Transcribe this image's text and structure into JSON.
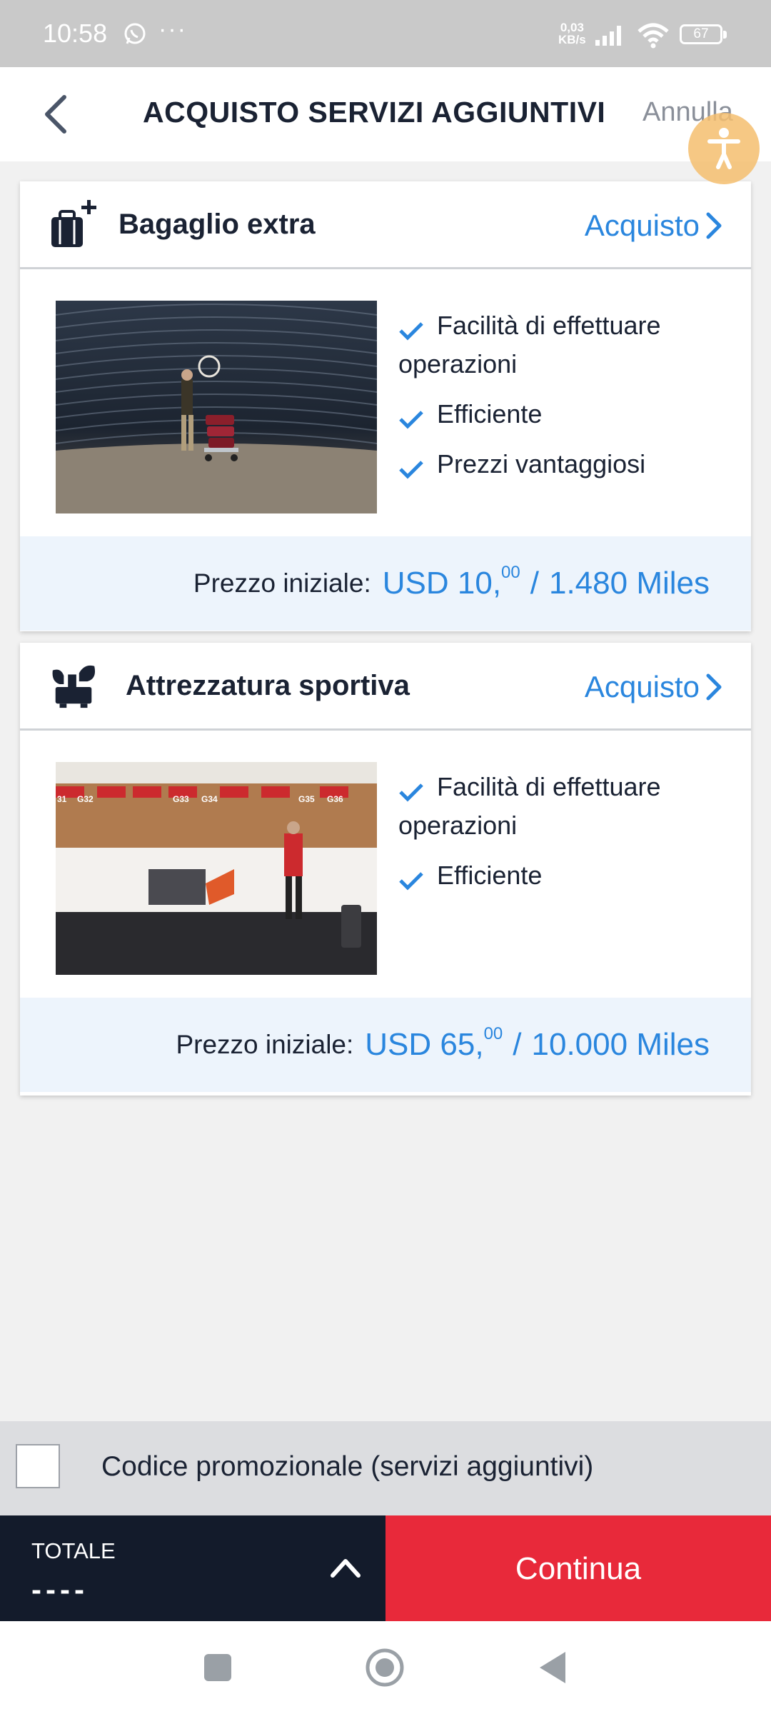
{
  "status_bar": {
    "time": "10:58",
    "notification_more": "···",
    "net_speed_value": "0,03",
    "net_speed_unit": "KB/s",
    "battery": "67"
  },
  "header": {
    "title": "ACQUISTO SERVIZI AGGIUNTIVI",
    "cancel_label": "Annulla"
  },
  "services": [
    {
      "title": "Bagaglio extra",
      "icon": "luggage-plus-icon",
      "buy_label": "Acquisto",
      "features": [
        "Facilità di effettuare operazioni",
        "Efficiente",
        "Prezzi vantaggiosi"
      ],
      "price_label": "Prezzo iniziale:",
      "price_main": "USD 10,",
      "price_decimals": "00",
      "price_separator": "/",
      "price_miles": "1.480 Miles"
    },
    {
      "title": "Attrezzatura sportiva",
      "icon": "sports-equipment-icon",
      "buy_label": "Acquisto",
      "features": [
        "Facilità di effettuare operazioni",
        "Efficiente"
      ],
      "price_label": "Prezzo iniziale:",
      "price_main": "USD 65,",
      "price_decimals": "00",
      "price_separator": "/",
      "price_miles": "10.000 Miles"
    }
  ],
  "photo2_signs": [
    "31",
    "G32",
    "G33",
    "G34",
    "G35",
    "G36"
  ],
  "promo": {
    "label": "Codice promozionale (servizi aggiuntivi)",
    "checked": false
  },
  "footer": {
    "total_label": "TOTALE",
    "total_value": "----",
    "continue_label": "Continua"
  },
  "colors": {
    "accent_blue": "#2a86de",
    "navy": "#131b2b",
    "continue_red": "#e8293a",
    "price_bg": "#edf4fc"
  }
}
